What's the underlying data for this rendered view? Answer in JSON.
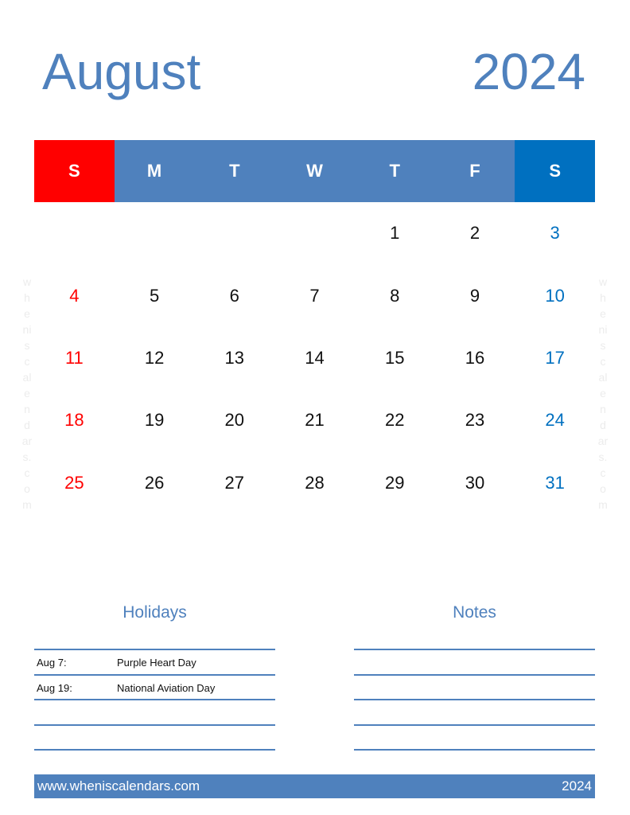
{
  "title": {
    "month": "August",
    "year": "2024"
  },
  "weekdays": [
    "S",
    "M",
    "T",
    "W",
    "T",
    "F",
    "S"
  ],
  "weeks": [
    [
      "",
      "",
      "",
      "",
      "1",
      "2",
      "3"
    ],
    [
      "4",
      "5",
      "6",
      "7",
      "8",
      "9",
      "10"
    ],
    [
      "11",
      "12",
      "13",
      "14",
      "15",
      "16",
      "17"
    ],
    [
      "18",
      "19",
      "20",
      "21",
      "22",
      "23",
      "24"
    ],
    [
      "25",
      "26",
      "27",
      "28",
      "29",
      "30",
      "31"
    ]
  ],
  "watermark": [
    "w",
    "h",
    "e",
    "ni",
    "s",
    "c",
    "al",
    "e",
    "n",
    "d",
    "ar",
    "s.",
    "c",
    "o",
    "m"
  ],
  "holidays": {
    "title": "Holidays",
    "items": [
      {
        "date": "Aug 7:",
        "name": "Purple Heart Day"
      },
      {
        "date": "Aug 19:",
        "name": "National Aviation Day"
      }
    ]
  },
  "notes": {
    "title": "Notes"
  },
  "footer": {
    "website": "www.wheniscalendars.com",
    "year": "2024"
  },
  "colors": {
    "accent": "#4f81bd",
    "sunday": "#ff0000",
    "saturday": "#0070c0"
  }
}
